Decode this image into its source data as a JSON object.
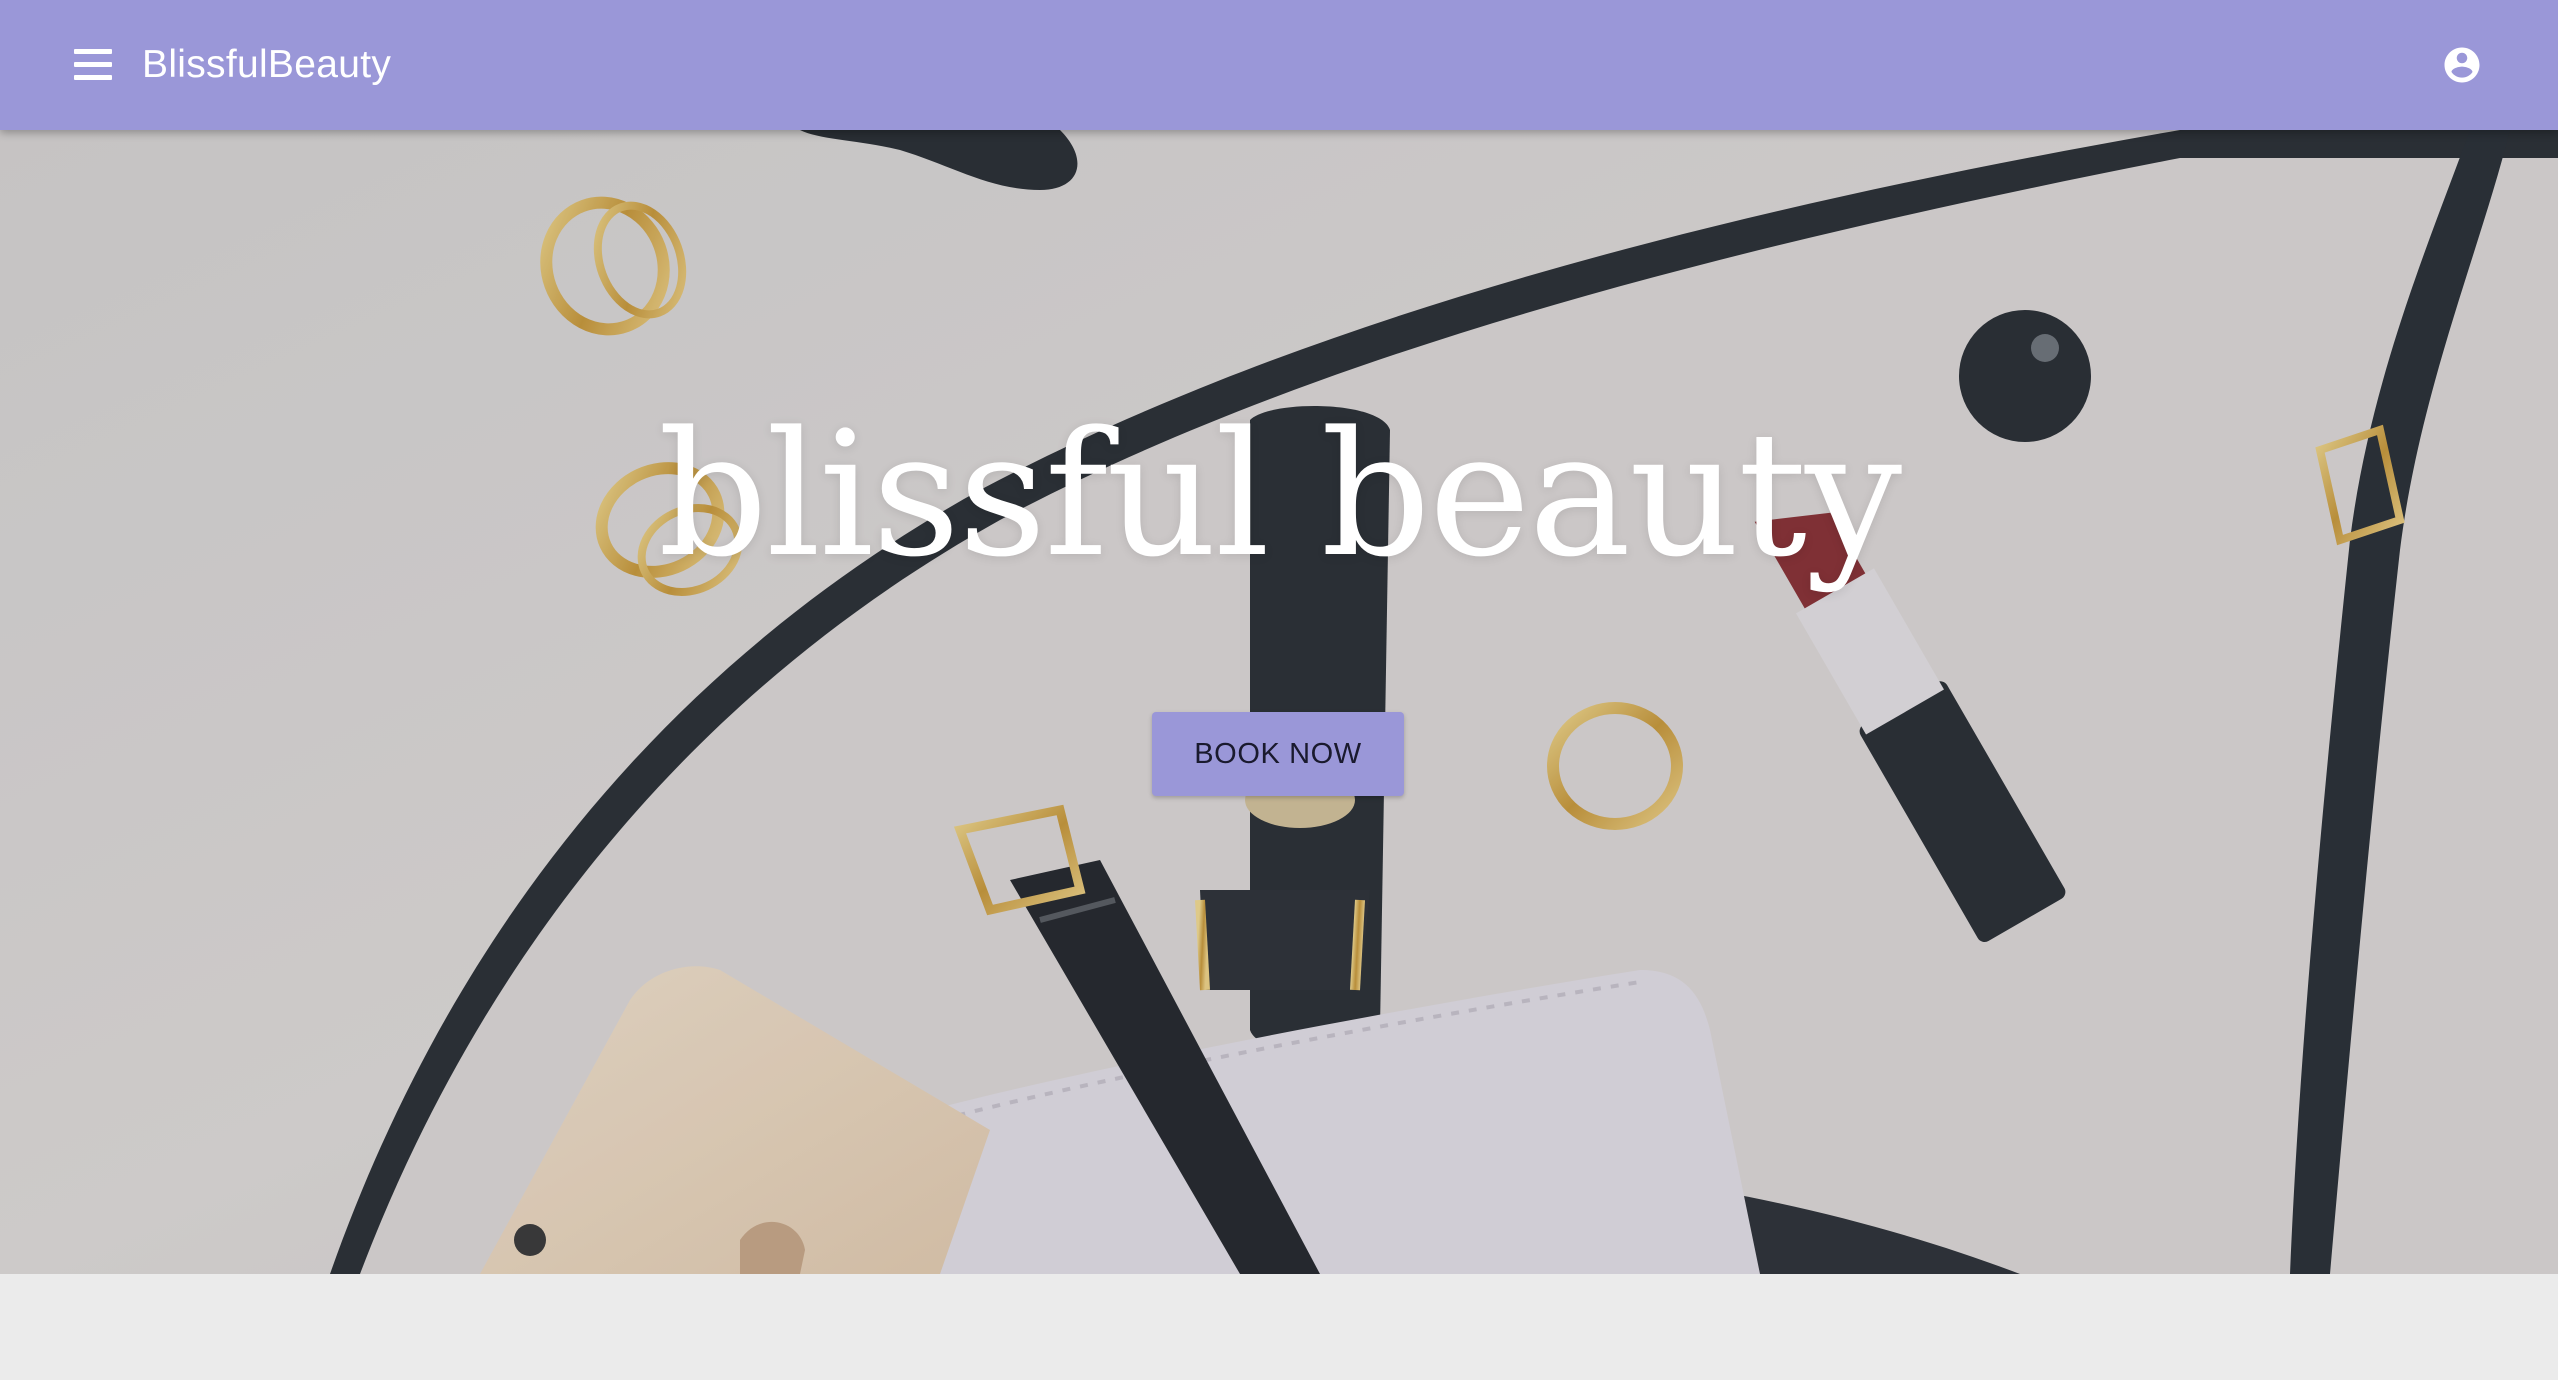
{
  "appbar": {
    "brand": "BlissfulBeauty",
    "menu_icon": "hamburger-menu-icon",
    "account_icon": "account-circle-icon",
    "color": "#9a97d8"
  },
  "hero": {
    "title": "blissful beauty",
    "cta_label": "BOOK NOW",
    "background_image": "flat-lay of handbag, rings, wristwatch, lipstick, nail polish, phone and wallet"
  },
  "colors": {
    "accent": "#9a97d8",
    "page_background": "#ebebeb",
    "title_text": "#ffffff"
  }
}
